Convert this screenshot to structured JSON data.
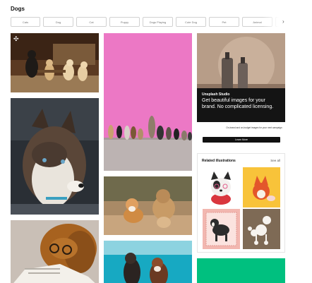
{
  "page": {
    "title": "Dogs"
  },
  "chips": [
    "Cats",
    "Dog",
    "Cat",
    "Puppy",
    "Dogs Playing",
    "Cute Dog",
    "Pet",
    "Animal"
  ],
  "chip_next_icon": "chevron-right-icon",
  "expand_icon": "expand-arrows-icon",
  "ad": {
    "brand": "Unsplash Studio",
    "headline": "Get beautiful images for your brand. No complicated licensing.",
    "copy": "On-brand and on-budget images for your next campaign",
    "button": "Learn More"
  },
  "related": {
    "title": "Related illustrations",
    "see_all": "See all"
  },
  "colors": {
    "ad_accent": "#111111",
    "green_tile": "#00c07f",
    "pink_photo": "#ec78c5"
  }
}
